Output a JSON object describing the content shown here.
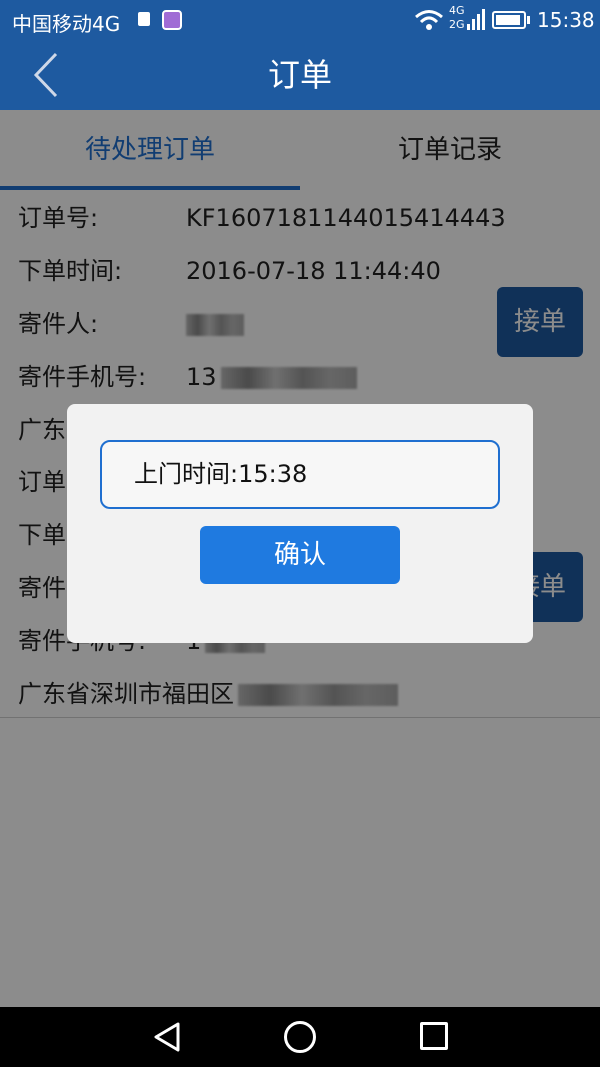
{
  "status_bar": {
    "carrier": "中国移动4G",
    "network_top": "4G",
    "network_bottom": "2G",
    "time": "15:38"
  },
  "header": {
    "title": "订单"
  },
  "tabs": [
    {
      "label": "待处理订单",
      "active": true
    },
    {
      "label": "订单记录",
      "active": false
    }
  ],
  "orders": [
    {
      "order_no_label": "订单号:",
      "order_no": "KF1607181144015414443",
      "time_label": "下单时间:",
      "time": "2016-07-18 11:44:40",
      "sender_label": "寄件人:",
      "phone_label": "寄件手机号:",
      "phone_prefix": "13",
      "address_prefix": "广东",
      "accept_label": "接单"
    },
    {
      "order_no_label": "订单",
      "time_label": "下单",
      "sender_label": "寄件",
      "phone_label": "寄件手机号:",
      "phone_prefix": "1",
      "address_prefix": "广东省深圳市福田区",
      "accept_label": "接单"
    }
  ],
  "dialog": {
    "time_text": "上门时间:15:38",
    "confirm_label": "确认"
  },
  "colors": {
    "primary": "#1e5aa0",
    "accent": "#1f6fd0",
    "button": "#1f7ae0"
  }
}
